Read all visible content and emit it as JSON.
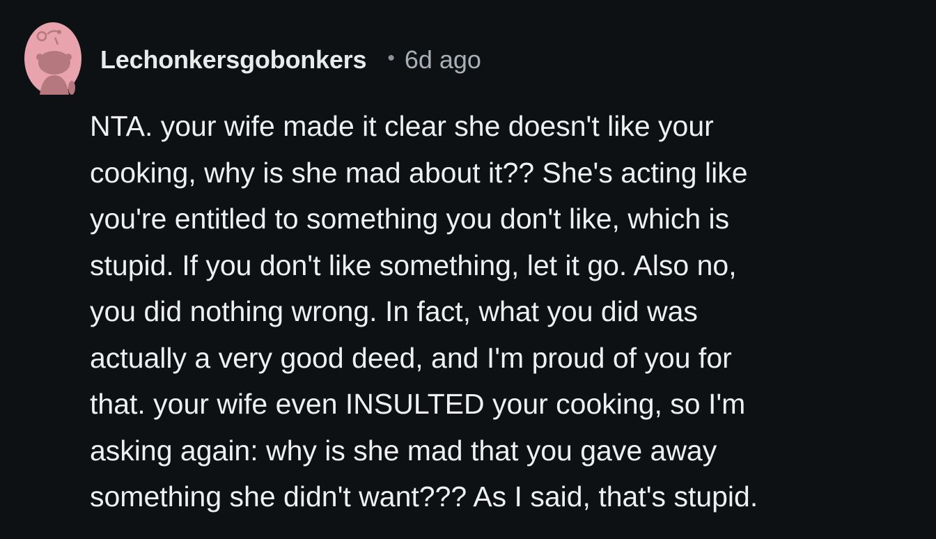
{
  "comment": {
    "author": "Lechonkersgobonkers",
    "separator": "•",
    "timestamp": "6d ago",
    "avatar_icon": "snoo-avatar-icon",
    "body_lines": [
      "NTA. your wife made it clear she doesn't like your",
      "cooking, why is she mad about it?? She's acting like",
      "you're entitled to something you don't like, which is",
      "stupid. If you don't like something, let it go. Also no,",
      "you did nothing wrong. In fact, what you did was",
      "actually a very good deed, and I'm proud of you for",
      "that. your wife even INSULTED your cooking, so I'm",
      "asking again: why is she mad that you gave away",
      "something she didn't want??? As I said, that's stupid."
    ]
  },
  "colors": {
    "background": "#0e1113",
    "text": "#eef0f2",
    "meta": "#a7b0b6",
    "avatar_bg": "#e8a3ad",
    "avatar_figure": "#b5787f"
  }
}
